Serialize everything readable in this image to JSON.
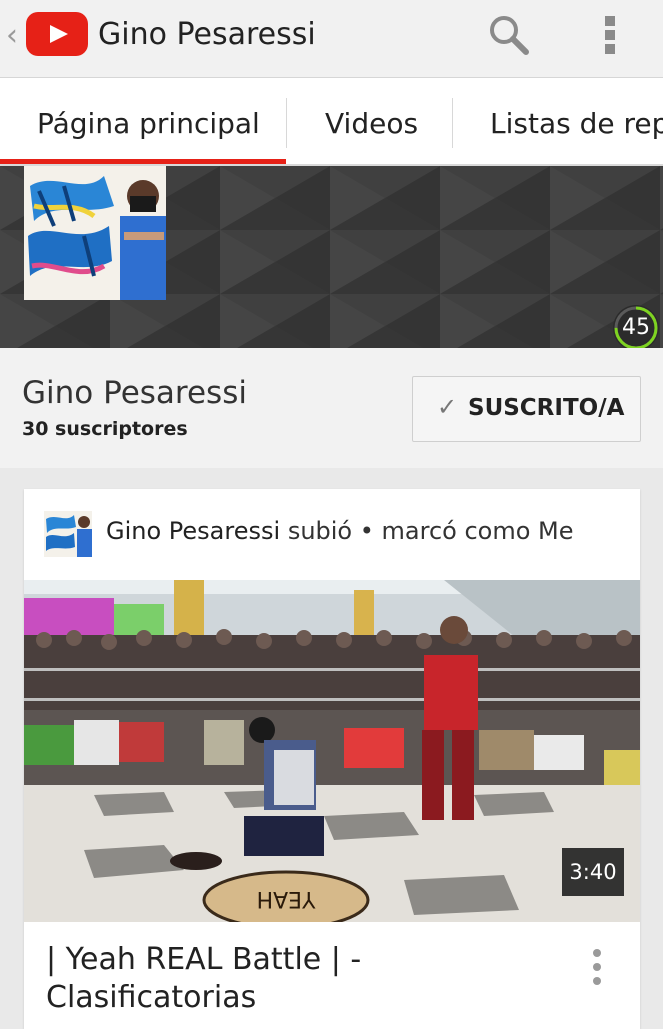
{
  "header": {
    "title": "Gino Pesaressi",
    "back_icon": "chevron-left",
    "logo": "youtube-logo",
    "search_icon": "search-icon",
    "more_icon": "more-vert-icon"
  },
  "tabs": [
    {
      "label": "Página principal",
      "active": true
    },
    {
      "label": "Videos",
      "active": false
    },
    {
      "label": "Listas de repr",
      "active": false
    }
  ],
  "banner": {
    "counter": "45",
    "counter_progress": 0.75
  },
  "channel": {
    "name": "Gino Pesaressi",
    "subscribers": "30 suscriptores",
    "subscribe_label": "SUSCRITO/A"
  },
  "feed": {
    "uploader": "Gino Pesaressi",
    "activity": "subió • marcó como Me",
    "video": {
      "duration": "3:40",
      "title": "| Yeah REAL Battle | - Clasificatorias"
    }
  },
  "colors": {
    "accent": "#e62117",
    "banner_bg": "#3d3d3d",
    "progress": "#7ed321"
  }
}
